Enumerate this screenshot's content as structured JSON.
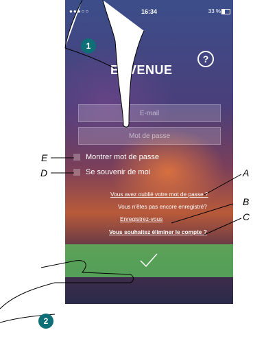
{
  "statusbar": {
    "carrier": "●●●○○",
    "time": "16:34",
    "battery": "33 %"
  },
  "help": {
    "label": "?"
  },
  "title": "ENVENUE",
  "fields": {
    "email_placeholder": "E-mail",
    "password_placeholder": "Mot de passe"
  },
  "options": {
    "show_password": "Montrer mot de passe",
    "remember_me": "Se souvenir de moi"
  },
  "links": {
    "forgot_password": "Vous avez oublié votre mot de passe ?",
    "not_registered": "Vous n'êtes pas encore enregistré?",
    "register": "Enregistrez-vous",
    "delete_account": "Vous souhaitez éliminer le compte ?"
  },
  "callouts": {
    "a": "A",
    "b": "B",
    "c": "C",
    "d": "D",
    "e": "E"
  },
  "steps": {
    "one": "1",
    "two": "2"
  },
  "colors": {
    "step_badge": "#0e6f77",
    "submit": "#5ab45a"
  }
}
